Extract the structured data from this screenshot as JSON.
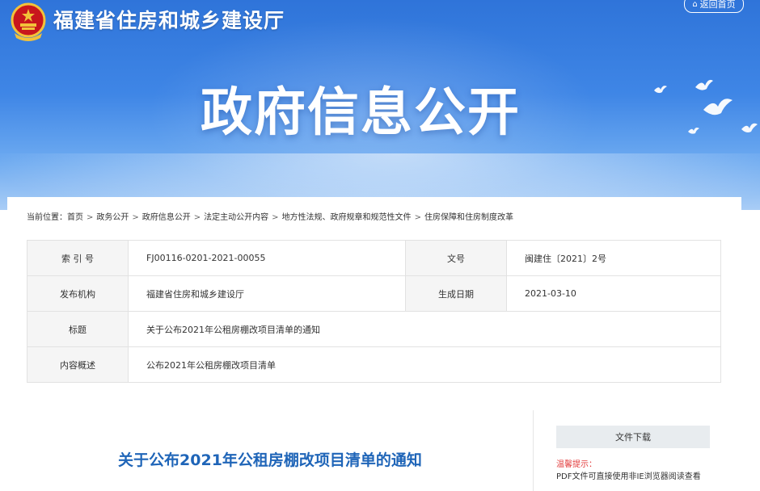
{
  "header": {
    "site_name": "福建省住房和城乡建设厅",
    "back_home_label": "返回首页",
    "hero_title": "政府信息公开"
  },
  "breadcrumb": {
    "prefix": "当前位置：",
    "items": [
      "首页",
      "政务公开",
      "政府信息公开",
      "法定主动公开内容",
      "地方性法规、政府规章和规范性文件",
      "住房保障和住房制度改革"
    ],
    "separator": ">"
  },
  "meta": {
    "index_label": "索 引 号",
    "index_value": "FJ00116-0201-2021-00055",
    "docno_label": "文号",
    "docno_value": "闽建住〔2021〕2号",
    "publisher_label": "发布机构",
    "publisher_value": "福建省住房和城乡建设厅",
    "date_label": "生成日期",
    "date_value": "2021-03-10",
    "title_label": "标题",
    "title_value": "关于公布2021年公租房棚改项目清单的通知",
    "summary_label": "内容概述",
    "summary_value": "公布2021年公租房棚改项目清单"
  },
  "document": {
    "title": "关于公布2021年公租房棚改项目清单的通知"
  },
  "sidebar": {
    "download_label": "文件下载",
    "tip_label": "温馨提示：",
    "tip_text": "PDF文件可直接使用非IE浏览器阅读查看"
  },
  "colors": {
    "banner_top": "#2f74d9",
    "banner_bottom": "#a9cdf6",
    "doc_title": "#1f65b8",
    "tip_red": "#e23b3b",
    "table_label_bg": "#f5f5f5"
  },
  "icons": {
    "emblem": "national-emblem-icon",
    "home": "home-icon",
    "doves": "dove-icon"
  }
}
